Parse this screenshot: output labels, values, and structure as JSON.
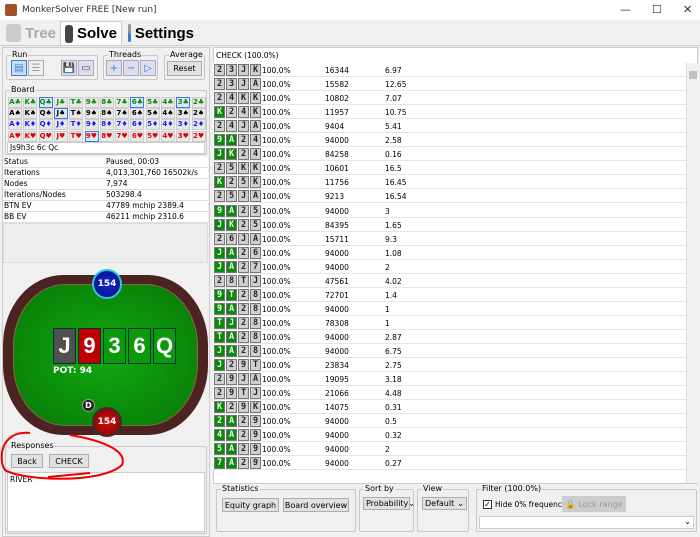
{
  "window": {
    "title": "MonkerSolver FREE [New run]"
  },
  "tabs": [
    {
      "label": "Tree"
    },
    {
      "label": "Solve"
    },
    {
      "label": "Settings"
    }
  ],
  "run": {
    "label": "Run"
  },
  "threads": {
    "label": "Threads"
  },
  "average": {
    "label": "Average",
    "reset": "Reset"
  },
  "board": {
    "label": "Board",
    "ranks": [
      "A",
      "K",
      "Q",
      "J",
      "T",
      "9",
      "8",
      "7",
      "6",
      "5",
      "4",
      "3",
      "2"
    ],
    "suits": [
      {
        "sym": "♣",
        "color": "#0a8a0a"
      },
      {
        "sym": "♠",
        "color": "#000000"
      },
      {
        "sym": "♦",
        "color": "#1a1aff"
      },
      {
        "sym": "♥",
        "color": "#e00000"
      }
    ],
    "selected": [
      "Q♣",
      "6♣",
      "3♣",
      "J♠",
      "9♥"
    ],
    "input": "Js9h3c 6c Qc"
  },
  "stats": [
    {
      "k": "Status",
      "v": "Paused, 00:03"
    },
    {
      "k": "Iterations",
      "v": "4,013,301,760  16502k/s 15 th..."
    },
    {
      "k": "Nodes",
      "v": "7,974"
    },
    {
      "k": "Iterations/Nodes",
      "v": "503298.4"
    },
    {
      "k": "BTN EV",
      "v": "47789 mchip    2389.4 bb/100"
    },
    {
      "k": "BB EV",
      "v": "46211 mchip    2310.6 bb/100"
    }
  ],
  "table": {
    "top_stack": "154",
    "bottom_stack": "154",
    "dealer": "D",
    "pot": "POT: 94",
    "cards": [
      {
        "r": "J",
        "color": "#505050"
      },
      {
        "r": "9",
        "color": "#c00000"
      },
      {
        "r": "3",
        "color": "#0a9a0a"
      },
      {
        "r": "6",
        "color": "#0a9a0a"
      },
      {
        "r": "Q",
        "color": "#0a9a0a"
      }
    ]
  },
  "responses": {
    "label": "Responses",
    "back": "Back",
    "check": "CHECK",
    "node": "RIVER"
  },
  "list": {
    "header": "CHECK (100.0%)",
    "rows": [
      {
        "cards": "23JK",
        "green": 0,
        "pct": "100.0%",
        "n": "16344",
        "ev": "6.97"
      },
      {
        "cards": "23JA",
        "green": 0,
        "pct": "100.0%",
        "n": "15582",
        "ev": "12.65"
      },
      {
        "cards": "24KK",
        "green": 0,
        "pct": "100.0%",
        "n": "10802",
        "ev": "7.07"
      },
      {
        "cards": "K24K",
        "green": 1,
        "pct": "100.0%",
        "n": "11957",
        "ev": "10.75"
      },
      {
        "cards": "24JA",
        "green": 0,
        "pct": "100.0%",
        "n": "9404",
        "ev": "5.41"
      },
      {
        "cards": "9A24",
        "green": 2,
        "pct": "100.0%",
        "n": "94000",
        "ev": "2.58"
      },
      {
        "cards": "JK24",
        "green": 2,
        "pct": "100.0%",
        "n": "84258",
        "ev": "0.16"
      },
      {
        "cards": "25KK",
        "green": 0,
        "pct": "100.0%",
        "n": "10601",
        "ev": "16.5"
      },
      {
        "cards": "K25K",
        "green": 1,
        "pct": "100.0%",
        "n": "11756",
        "ev": "16.45"
      },
      {
        "cards": "25JA",
        "green": 0,
        "pct": "100.0%",
        "n": "9213",
        "ev": "16.54"
      },
      {
        "cards": "9A25",
        "green": 2,
        "pct": "100.0%",
        "n": "94000",
        "ev": "3"
      },
      {
        "cards": "JK25",
        "green": 2,
        "pct": "100.0%",
        "n": "84395",
        "ev": "1.65"
      },
      {
        "cards": "26JA",
        "green": 0,
        "pct": "100.0%",
        "n": "15711",
        "ev": "9.3"
      },
      {
        "cards": "JA26",
        "green": 2,
        "pct": "100.0%",
        "n": "94000",
        "ev": "1.08"
      },
      {
        "cards": "JA27",
        "green": 2,
        "pct": "100.0%",
        "n": "94000",
        "ev": "2"
      },
      {
        "cards": "28TJ",
        "green": 0,
        "pct": "100.0%",
        "n": "47561",
        "ev": "4.02"
      },
      {
        "cards": "9T28",
        "green": 2,
        "pct": "100.0%",
        "n": "72701",
        "ev": "1.4"
      },
      {
        "cards": "9A28",
        "green": 2,
        "pct": "100.0%",
        "n": "94000",
        "ev": "1"
      },
      {
        "cards": "TJ28",
        "green": 2,
        "pct": "100.0%",
        "n": "78308",
        "ev": "1"
      },
      {
        "cards": "TA28",
        "green": 2,
        "pct": "100.0%",
        "n": "94000",
        "ev": "2.87"
      },
      {
        "cards": "JA28",
        "green": 2,
        "pct": "100.0%",
        "n": "94000",
        "ev": "6.75"
      },
      {
        "cards": "J29T",
        "green": 1,
        "pct": "100.0%",
        "n": "23834",
        "ev": "2.75"
      },
      {
        "cards": "29JA",
        "green": 0,
        "pct": "100.0%",
        "n": "19095",
        "ev": "3.18"
      },
      {
        "cards": "29TJ",
        "green": 0,
        "pct": "100.0%",
        "n": "21066",
        "ev": "4.48"
      },
      {
        "cards": "K29K",
        "green": 1,
        "pct": "100.0%",
        "n": "14075",
        "ev": "0.31"
      },
      {
        "cards": "2A29",
        "green": 2,
        "pct": "100.0%",
        "n": "94000",
        "ev": "0.5"
      },
      {
        "cards": "4A29",
        "green": 2,
        "pct": "100.0%",
        "n": "94000",
        "ev": "0.32"
      },
      {
        "cards": "5A29",
        "green": 2,
        "pct": "100.0%",
        "n": "94000",
        "ev": "2"
      },
      {
        "cards": "7A29",
        "green": 2,
        "pct": "100.0%",
        "n": "94000",
        "ev": "0.27"
      }
    ]
  },
  "bottom": {
    "statistics": "Statistics",
    "equity_graph": "Equity graph",
    "board_overview": "Board overview",
    "sort_by": "Sort by",
    "sort_value": "Probability",
    "view": "View",
    "view_value": "Default",
    "filter": "Filter (100.0%)",
    "hide_zero": "Hide 0% frequencies",
    "hide_zero_checked": true,
    "lock_range": "Lock range"
  }
}
